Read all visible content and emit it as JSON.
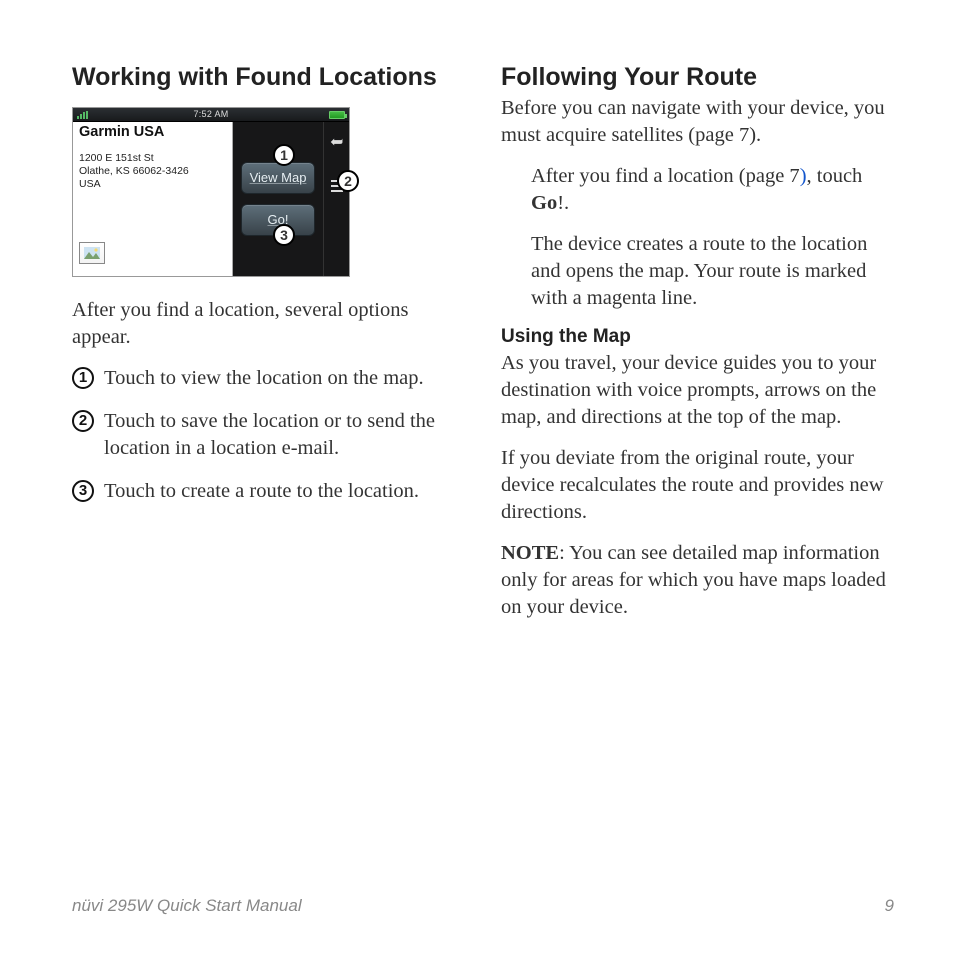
{
  "left": {
    "heading": "Working with Found Locations",
    "figure": {
      "time": "7:52 AM",
      "location_name": "Garmin USA",
      "address_line1": "1200 E 151st St",
      "address_line2": "Olathe, KS 66062-3426",
      "address_line3": "USA",
      "btn_view_map": "View Map",
      "btn_go": "Go!",
      "callouts": {
        "c1": "1",
        "c2": "2",
        "c3": "3"
      }
    },
    "intro": "After you find a location, several options appear.",
    "items": [
      {
        "num": "1",
        "text": "Touch to view the location on the map."
      },
      {
        "num": "2",
        "text": "Touch to save the location or to send the location in a location e-mail."
      },
      {
        "num": "3",
        "text": "Touch to create a route to the location."
      }
    ]
  },
  "right": {
    "heading": "Following Your Route",
    "p1": "Before you can navigate with your device, you must acquire satellites (page 7).",
    "step_pre": "After you find a location (page 7",
    "step_close": ")",
    "step_post_a": ", touch ",
    "step_go": "Go",
    "step_post_b": "!.",
    "step_result": "The device creates a route to the location and opens the map. Your route is marked with a magenta line.",
    "sub": "Using the Map",
    "p2": "As you travel, your device guides you to your destination with voice prompts, arrows on the map, and directions at the top of the map.",
    "p3": "If you deviate from the original route, your device recalculates the route and provides new directions.",
    "note_label": "NOTE",
    "note_body": ": You can see detailed map information only for areas for which you have maps loaded on your device."
  },
  "footer": {
    "manual": "nüvi 295W Quick Start Manual",
    "page": "9"
  }
}
